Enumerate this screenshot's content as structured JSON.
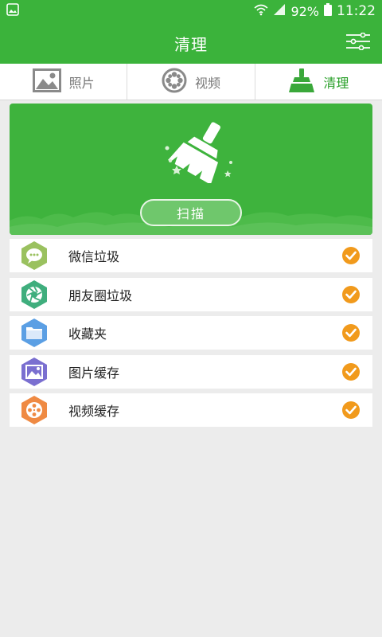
{
  "status_bar": {
    "battery": "92%",
    "time": "11:22"
  },
  "app_bar": {
    "title": "清理",
    "settings_icon": "sliders-icon"
  },
  "tabs": [
    {
      "label": "照片",
      "icon": "image-icon",
      "active": false
    },
    {
      "label": "视频",
      "icon": "film-reel-icon",
      "active": false
    },
    {
      "label": "清理",
      "icon": "broom-icon",
      "active": true
    }
  ],
  "hero": {
    "scan_label": "扫描"
  },
  "items": [
    {
      "label": "微信垃圾",
      "icon": "wechat-icon",
      "color": "#9ac15f",
      "checked": true
    },
    {
      "label": "朋友圈垃圾",
      "icon": "aperture-icon",
      "color": "#3fae7d",
      "checked": true
    },
    {
      "label": "收藏夹",
      "icon": "folder-icon",
      "color": "#5b9fe4",
      "checked": true
    },
    {
      "label": "图片缓存",
      "icon": "image-icon",
      "color": "#7a6fd0",
      "checked": true
    },
    {
      "label": "视频缓存",
      "icon": "film-reel-icon",
      "color": "#ef8a43",
      "checked": true
    }
  ],
  "colors": {
    "primary": "#3bb33b",
    "check": "#f19a1c",
    "background": "#ececec"
  }
}
